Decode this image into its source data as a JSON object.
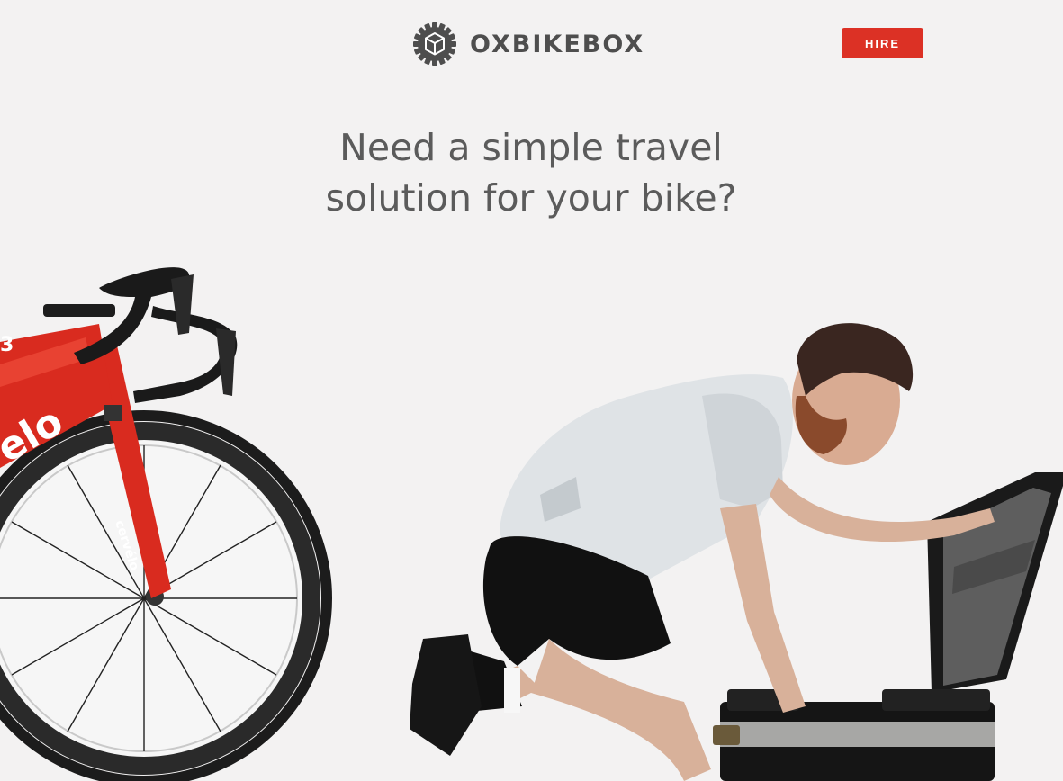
{
  "header": {
    "brand": "OXBIKEBOX",
    "logo_icon": "gear-box-logo-icon",
    "hire_label": "HIRE"
  },
  "hero": {
    "headline_line1": "Need a simple travel",
    "headline_line2": "solution for your bike?",
    "image": "man-packing-road-bike-into-case"
  },
  "colors": {
    "background": "#f3f2f2",
    "accent": "#dc3125",
    "text": "#5b5b5b",
    "logo": "#4e4e4e"
  }
}
